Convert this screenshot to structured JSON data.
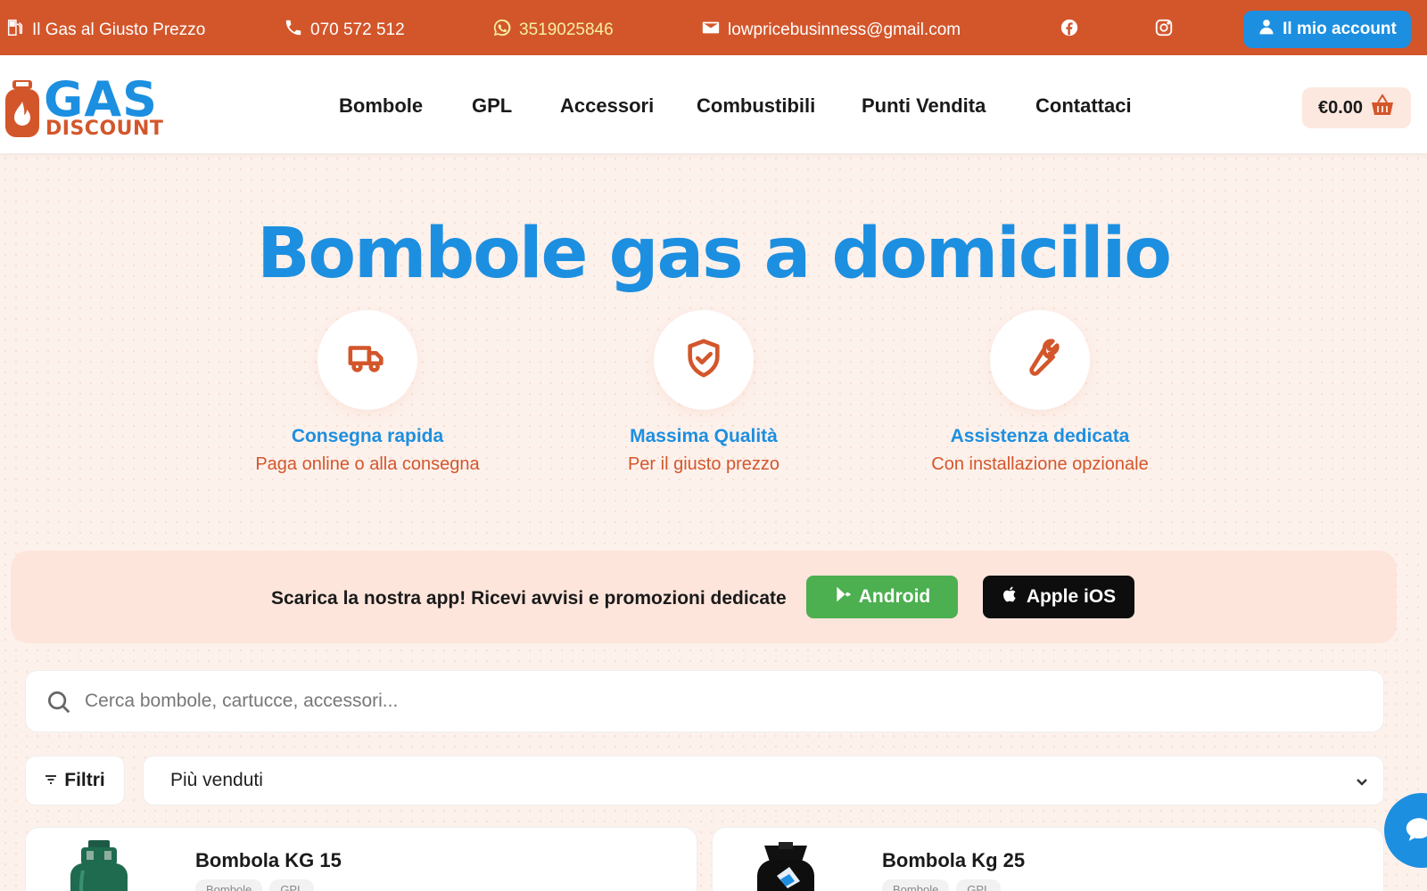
{
  "topbar": {
    "slogan": "Il Gas al Giusto Prezzo",
    "phone": "070 572 512",
    "whatsapp": "3519025846",
    "email": "lowpricebusinness@gmail.com",
    "account_label": "Il mio account",
    "icons": [
      "gas-pump-icon",
      "phone-icon",
      "whatsapp-icon",
      "mail-icon",
      "facebook-icon",
      "instagram-icon",
      "user-icon"
    ]
  },
  "nav": {
    "logo_top": "GAS",
    "logo_bottom": "DISCOUNT",
    "items": [
      {
        "label": "Bombole"
      },
      {
        "label": "GPL"
      },
      {
        "label": "Accessori"
      },
      {
        "label": "Combustibili"
      },
      {
        "label": "Punti Vendita"
      },
      {
        "label": "Contattaci"
      }
    ],
    "cart_total": "€0.00"
  },
  "hero": {
    "title": "Bombole gas a domicilio",
    "features": [
      {
        "icon": "truck-icon",
        "title": "Consegna rapida",
        "subtitle": "Paga online o alla consegna"
      },
      {
        "icon": "shield-check-icon",
        "title": "Massima Qualità",
        "subtitle": "Per il giusto prezzo"
      },
      {
        "icon": "wrench-icon",
        "title": "Assistenza dedicata",
        "subtitle": "Con installazione opzionale"
      }
    ]
  },
  "app_banner": {
    "text": "Scarica la nostra app! Ricevi avvisi e promozioni dedicate",
    "android_label": "Android",
    "ios_label": "Apple iOS"
  },
  "search": {
    "placeholder": "Cerca bombole, cartucce, accessori...",
    "value": ""
  },
  "filters": {
    "filter_label": "Filtri",
    "sort_selected": "Più venduti"
  },
  "products": [
    {
      "name": "Bombola KG 15",
      "tags": [
        "Bombole",
        "GPL"
      ]
    },
    {
      "name": "Bombola Kg 25",
      "tags": [
        "Bombole",
        "GPL"
      ]
    }
  ],
  "colors": {
    "brand_orange": "#d3562b",
    "brand_blue": "#1d8fe0",
    "android_green": "#4caf50",
    "background": "#fdf1ec"
  }
}
